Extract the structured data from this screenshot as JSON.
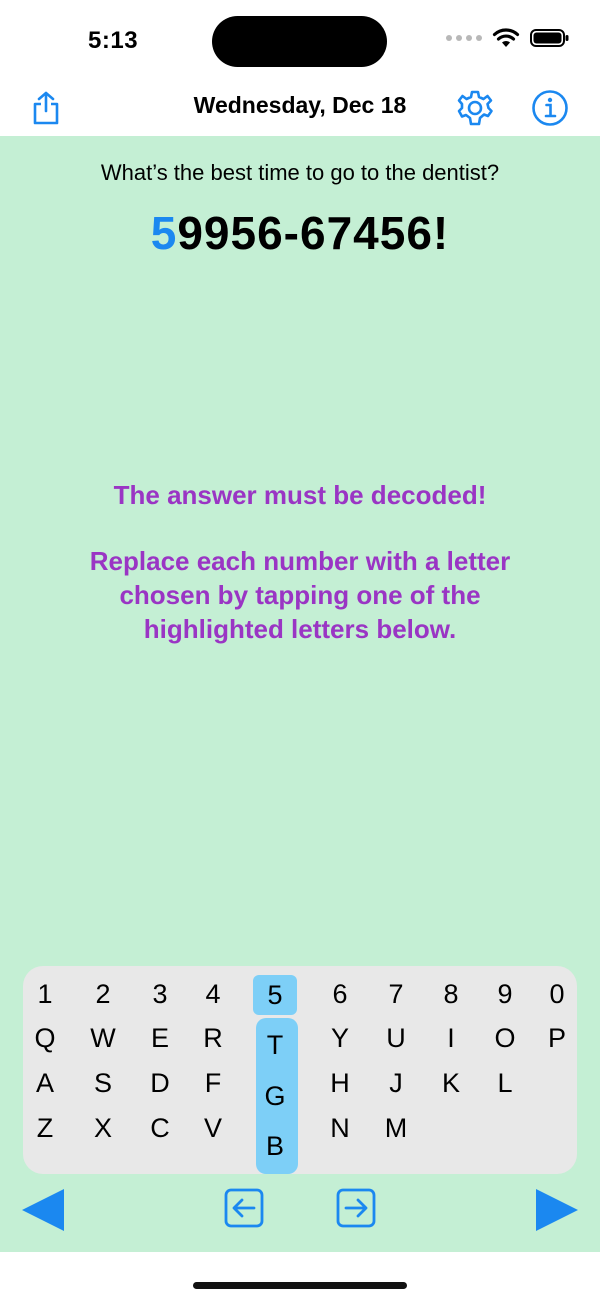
{
  "status": {
    "time": "5:13"
  },
  "nav": {
    "title": "Wednesday, Dec 18",
    "share_icon": "share-icon",
    "settings_icon": "gear-icon",
    "info_icon": "info-icon"
  },
  "puzzle": {
    "question": "What’s the best time to go to the dentist?",
    "code_first": "5",
    "code_rest": "9956-67456!"
  },
  "instructions": {
    "line1": "The answer must be decoded!",
    "line2": "Replace each number with a letter chosen by tapping one of the highlighted letters below."
  },
  "keyboard": {
    "row1": [
      "1",
      "2",
      "3",
      "4",
      "5",
      "6",
      "7",
      "8",
      "9",
      "0"
    ],
    "row2": [
      "Q",
      "W",
      "E",
      "R",
      "T",
      "Y",
      "U",
      "I",
      "O",
      "P"
    ],
    "row3": [
      "A",
      "S",
      "D",
      "F",
      "G",
      "H",
      "J",
      "K",
      "L"
    ],
    "row4": [
      "Z",
      "X",
      "C",
      "V",
      "B",
      "N",
      "M"
    ],
    "highlighted_column": [
      "5",
      "T",
      "G",
      "B"
    ]
  },
  "colors": {
    "accent": "#1b88f0",
    "background": "#c4efd4",
    "instruction": "#9a35c4",
    "highlight": "#7dcff7"
  }
}
